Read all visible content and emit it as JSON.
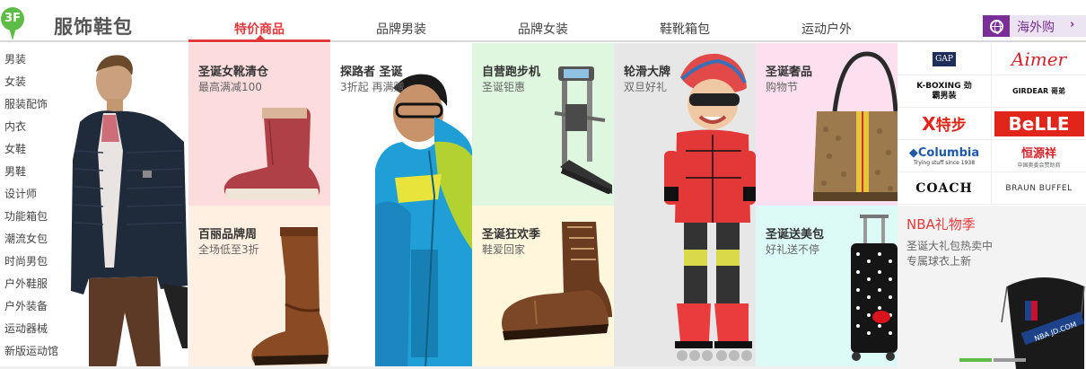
{
  "floor": {
    "number": "3F",
    "title": "服饰鞋包"
  },
  "tabs": [
    {
      "label": "特价商品",
      "active": true
    },
    {
      "label": "品牌男装"
    },
    {
      "label": "品牌女装"
    },
    {
      "label": "鞋靴箱包"
    },
    {
      "label": "运动户外"
    }
  ],
  "haiwai": {
    "label": "海外购",
    "arrow": "›"
  },
  "categories": [
    "男装",
    "女装",
    "服装配饰",
    "内衣",
    "女鞋",
    "男鞋",
    "设计师",
    "功能箱包",
    "潮流女包",
    "时尚男包",
    "户外鞋服",
    "户外装备",
    "运动器械",
    "新版运动馆"
  ],
  "tiles": {
    "boots": {
      "title": "圣诞女靴清仓",
      "sub": "最高满减100",
      "bg": "#fcdcdc"
    },
    "tanlu": {
      "title": "探路者 圣诞",
      "sub": "3折起 再满赠",
      "bg": "#ffffff"
    },
    "treadmill": {
      "title": "自营跑步机",
      "sub": "圣诞钜惠",
      "bg": "#dff6df"
    },
    "skate": {
      "title": "轮滑大牌",
      "sub": "双旦好礼",
      "bg": "#e7e7e7"
    },
    "handbag": {
      "title": "圣诞奢品",
      "sub": "购物节",
      "bg": "#fde0ef"
    },
    "brandweek": {
      "title": "百丽品牌周",
      "sub": "全场低至3折",
      "bg": "#fff0e2"
    },
    "craze": {
      "title": "圣诞狂欢季",
      "sub": "鞋爱回家",
      "bg": "#fff6dc"
    },
    "beauty": {
      "title": "圣诞送美包",
      "sub": "好礼送不停",
      "bg": "#dcfaf6"
    }
  },
  "brands": [
    "GAP",
    "Aimer",
    "K-BOXING 劲霸男装",
    "GIRDEAR 哥弟",
    "特步",
    "BeLLE",
    "Columbia",
    "恒源祥",
    "COACH",
    "BRAUN BUFFEL"
  ],
  "brand_extra": {
    "columbia_sub": "Trying stuff since 1938",
    "hengyuan_sub": "中国奥委会赞助商",
    "jd": "NBA JD.COM"
  },
  "nba": {
    "title": "NBA礼物季",
    "line1": "圣诞大礼包热卖中",
    "line2": "专属球衣上新"
  },
  "colors": {
    "accent": "#e4393c",
    "floor_green": "#5dbd46",
    "haiwai_purple": "#7a2e98",
    "carousel_active": "#5dbd46",
    "carousel_inactive": "#999999"
  }
}
